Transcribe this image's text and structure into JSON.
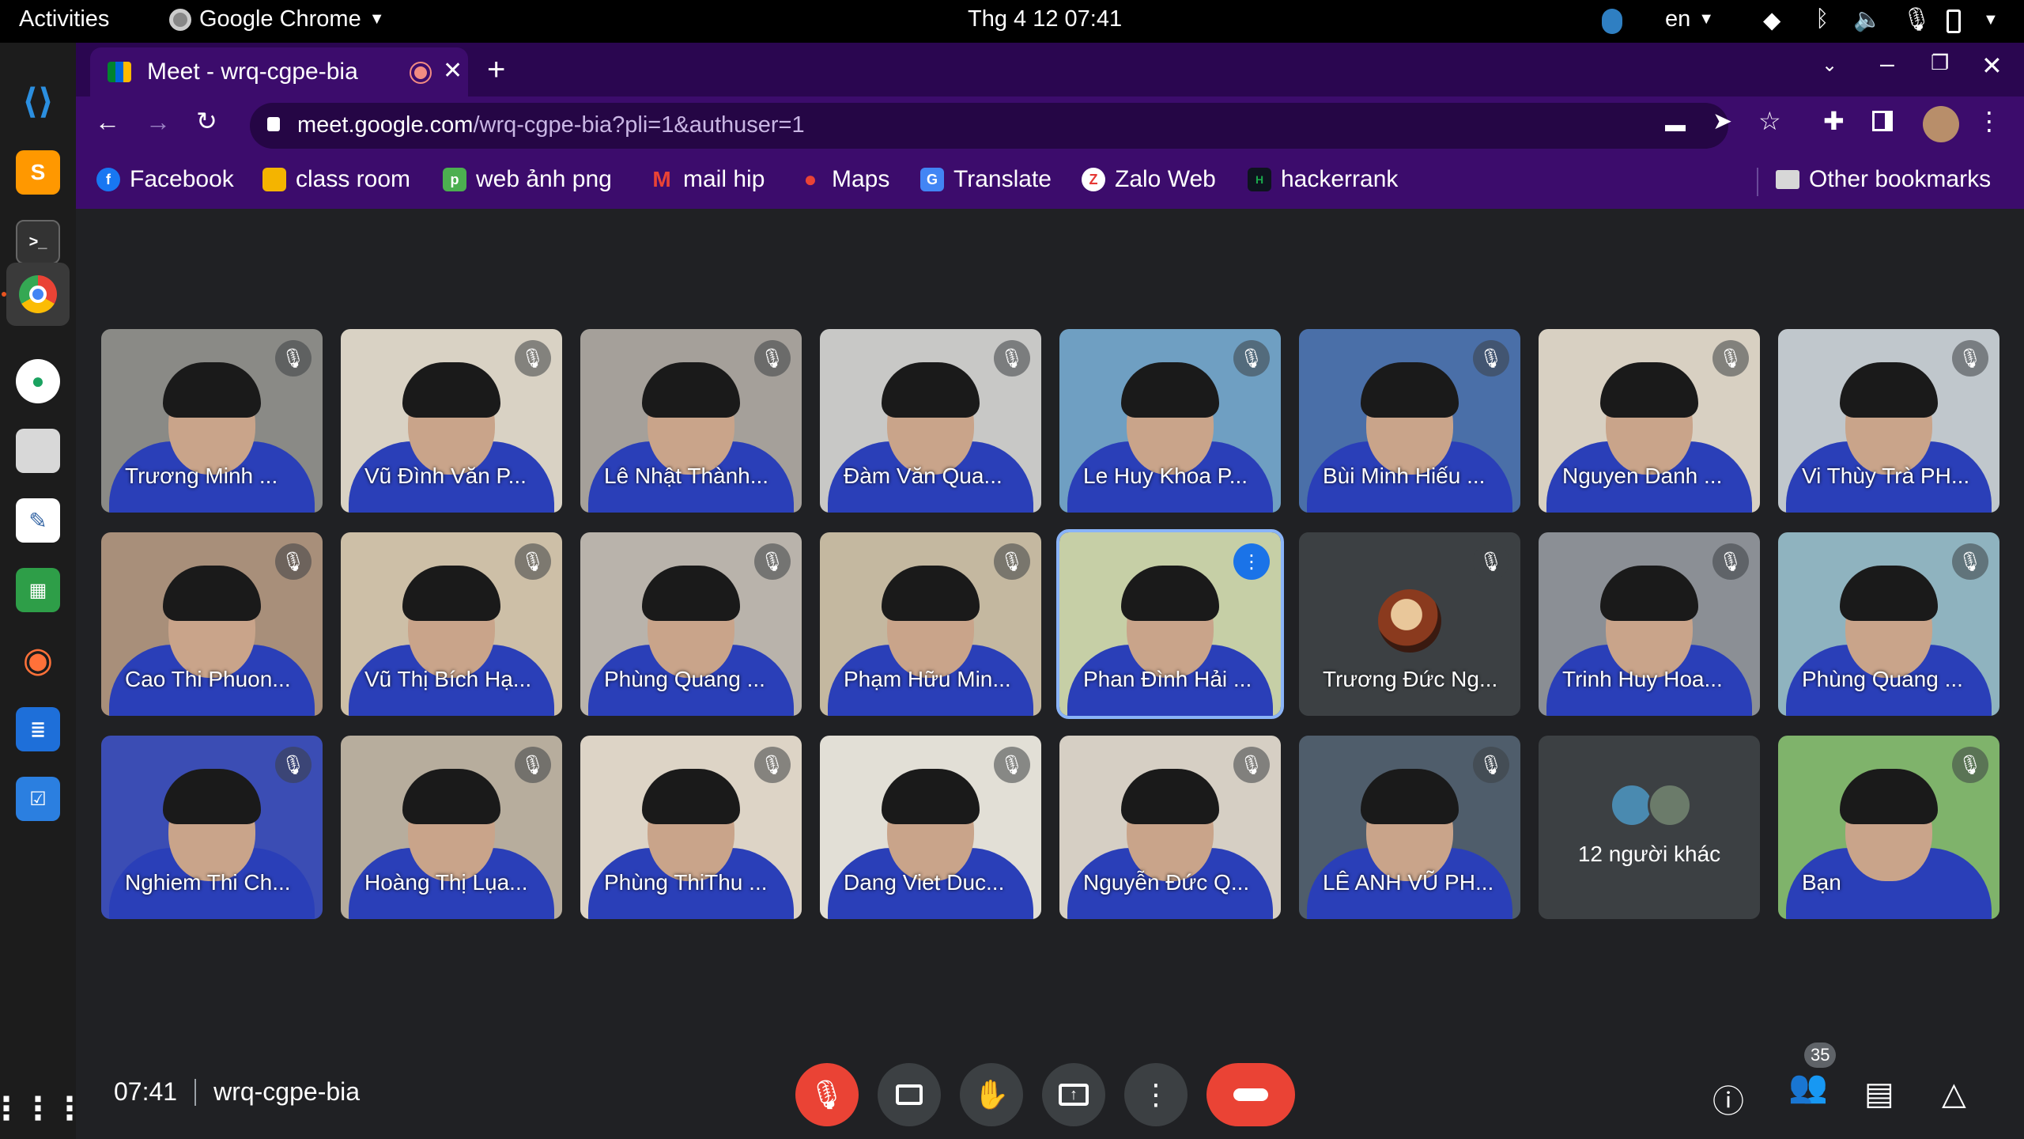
{
  "topbar": {
    "activities": "Activities",
    "app_menu": "Google Chrome",
    "datetime": "Thg 4 12  07:41",
    "language": "en"
  },
  "browser": {
    "tab_title": "Meet - wrq-cgpe-bia",
    "url_host": "meet.google.com",
    "url_path": "/wrq-cgpe-bia?pli=1&authuser=1",
    "bookmarks": [
      {
        "label": "Facebook",
        "icon": "facebook-icon",
        "color": "#1877f2"
      },
      {
        "label": "class room",
        "icon": "classroom-icon",
        "color": "#f4b400"
      },
      {
        "label": "web ảnh png",
        "icon": "png-site-icon",
        "color": "#4caf50"
      },
      {
        "label": "mail hip",
        "icon": "gmail-icon",
        "color": "#ea4335"
      },
      {
        "label": "Maps",
        "icon": "maps-icon",
        "color": "#34a853"
      },
      {
        "label": "Translate",
        "icon": "translate-icon",
        "color": "#4285f4"
      },
      {
        "label": "Zalo Web",
        "icon": "zalo-icon",
        "color": "#e53935"
      },
      {
        "label": "hackerrank",
        "icon": "hackerrank-icon",
        "color": "#1ba94c"
      }
    ],
    "other_bookmarks": "Other bookmarks"
  },
  "meet": {
    "participants": [
      {
        "name": "Trương Minh ...",
        "bg": "#8a8a86",
        "muted": true
      },
      {
        "name": "Vũ Đình Văn P...",
        "bg": "#d9d2c4",
        "muted": true
      },
      {
        "name": "Lê Nhật Thành...",
        "bg": "#a5a09a",
        "muted": true
      },
      {
        "name": "Đàm Văn Qua...",
        "bg": "#c8c8c6",
        "muted": true
      },
      {
        "name": "Le Huy Khoa P...",
        "bg": "#6f9fc2",
        "muted": true
      },
      {
        "name": "Bùi Minh Hiếu ...",
        "bg": "#4a6fa8",
        "muted": true
      },
      {
        "name": "Nguyen Danh ...",
        "bg": "#d8d0c2",
        "muted": true
      },
      {
        "name": "Vi Thùy Trà PH...",
        "bg": "#c0c7cc",
        "muted": true
      },
      {
        "name": "Cao Thi Phuon...",
        "bg": "#a88f7a",
        "muted": true
      },
      {
        "name": "Vũ Thị Bích Hạ...",
        "bg": "#cdbfa7",
        "muted": true
      },
      {
        "name": "Phùng Quang ...",
        "bg": "#b9b3ab",
        "muted": true
      },
      {
        "name": "Phạm Hữu Min...",
        "bg": "#c4b8a0",
        "muted": true
      },
      {
        "name": "Phan Đình Hải ...",
        "bg": "#c6cfa6",
        "muted": false,
        "speaking": true
      },
      {
        "name": "Trương Đức Ng...",
        "bg": "#3c4043",
        "muted": true,
        "avatar": true
      },
      {
        "name": "Trinh Huy Hoa...",
        "bg": "#8b8f95",
        "muted": true
      },
      {
        "name": "Phùng Quang ...",
        "bg": "#8fb3bf",
        "muted": true
      },
      {
        "name": "Nghiem Thi Ch...",
        "bg": "#3b4db4",
        "muted": true
      },
      {
        "name": "Hoàng Thị Lụa...",
        "bg": "#b7ad9d",
        "muted": true
      },
      {
        "name": "Phùng ThiThu ...",
        "bg": "#ddd4c6",
        "muted": true
      },
      {
        "name": "Dang Viet Duc...",
        "bg": "#e2dfd6",
        "muted": true
      },
      {
        "name": "Nguyễn Đức Q...",
        "bg": "#d6cfc4",
        "muted": true
      },
      {
        "name": "LÊ ANH VŨ PH...",
        "bg": "#4f5d6b",
        "muted": true
      },
      {
        "name": "12 người khác",
        "bg": "#3c4043",
        "others": true
      },
      {
        "name": "Bạn",
        "bg": "#7fb36b",
        "muted": true
      }
    ],
    "bottom": {
      "time": "07:41",
      "meeting_code": "wrq-cgpe-bia",
      "people_count": "35"
    }
  },
  "colors": {
    "accent_red": "#ea4335",
    "chrome_purple": "#3c0c6c",
    "meet_bg": "#202124",
    "speaking_blue": "#8ab4f8"
  }
}
